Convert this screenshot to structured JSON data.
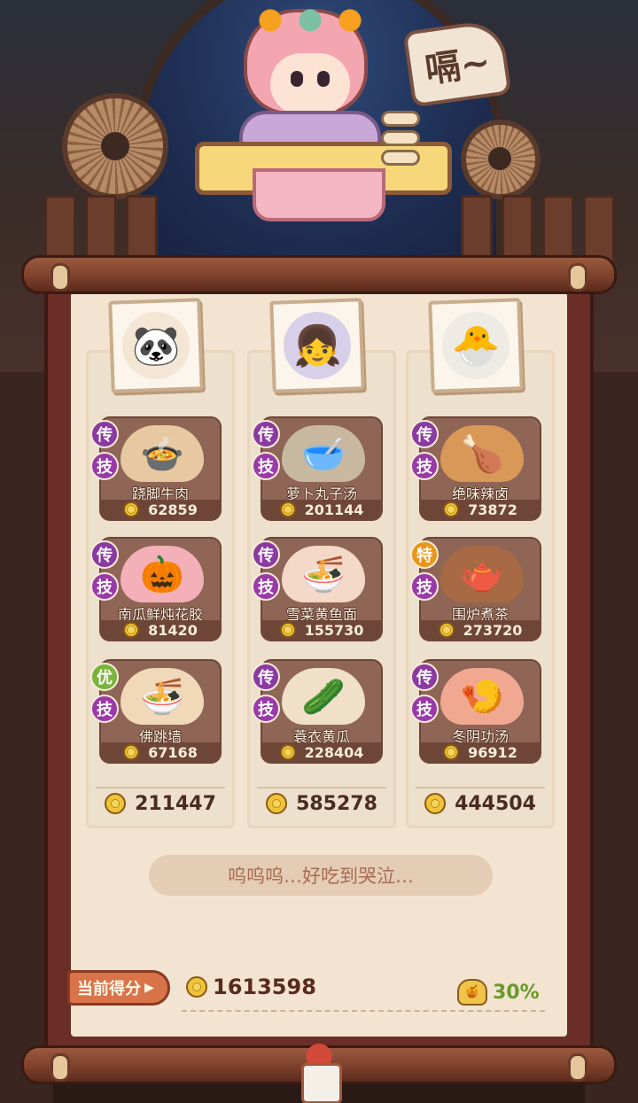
{
  "header": {
    "sound_text": "嗝~"
  },
  "columns": [
    {
      "portrait_icon": "panda-hood-character",
      "portrait_glyph": "🐼",
      "portrait_bg": "#f4e6d4",
      "dishes": [
        {
          "grade": "传",
          "skill": "技",
          "name": "跷脚牛肉",
          "score": "62859",
          "icon": "beef-stew",
          "glyph": "🍲",
          "plate": "#e8c8a0"
        },
        {
          "grade": "传",
          "skill": "技",
          "name": "南瓜鲜炖花胶",
          "score": "81420",
          "icon": "pumpkin-stew",
          "glyph": "🎃",
          "plate": "#f4b0b8"
        },
        {
          "grade": "优",
          "skill": "技",
          "name": "佛跳墙",
          "score": "67168",
          "icon": "buddha-jumps-wall",
          "glyph": "🍜",
          "plate": "#f0d8b8"
        }
      ],
      "total": "211447"
    },
    {
      "portrait_icon": "dark-hair-girl-character",
      "portrait_glyph": "👧",
      "portrait_bg": "#d8d0e8",
      "dishes": [
        {
          "grade": "传",
          "skill": "技",
          "name": "萝卜丸子汤",
          "score": "201144",
          "icon": "meatball-soup",
          "glyph": "🥣",
          "plate": "#c8b8a0"
        },
        {
          "grade": "传",
          "skill": "技",
          "name": "雪菜黄鱼面",
          "score": "155730",
          "icon": "fish-noodles",
          "glyph": "🍜",
          "plate": "#f4d8c8"
        },
        {
          "grade": "传",
          "skill": "技",
          "name": "蓑衣黄瓜",
          "score": "228404",
          "icon": "cucumber-dish",
          "glyph": "🥒",
          "plate": "#f0e0c8"
        }
      ],
      "total": "585278"
    },
    {
      "portrait_icon": "white-creature-character",
      "portrait_glyph": "🐣",
      "portrait_bg": "#eeeae4",
      "dishes": [
        {
          "grade": "传",
          "skill": "技",
          "name": "绝味辣卤",
          "score": "73872",
          "icon": "spicy-braised",
          "glyph": "🍗",
          "plate": "#d89858"
        },
        {
          "grade": "特",
          "skill": "技",
          "name": "围炉煮茶",
          "score": "273720",
          "icon": "stove-tea",
          "glyph": "🫖",
          "plate": "#a86a44"
        },
        {
          "grade": "传",
          "skill": "技",
          "name": "冬阴功汤",
          "score": "96912",
          "icon": "tom-yum-soup",
          "glyph": "🍤",
          "plate": "#f0a890"
        }
      ],
      "total": "444504"
    }
  ],
  "message": "呜呜呜…好吃到哭泣…",
  "footer": {
    "score_label": "当前得分",
    "total_score": "1613598",
    "bonus_percent": "30%"
  },
  "colors": {
    "grade_legend": "#8a3aa0",
    "grade_special": "#e8961c",
    "grade_good": "#7ab43a",
    "skill": "#9a3aa8",
    "bonus": "#6a9a2a"
  }
}
